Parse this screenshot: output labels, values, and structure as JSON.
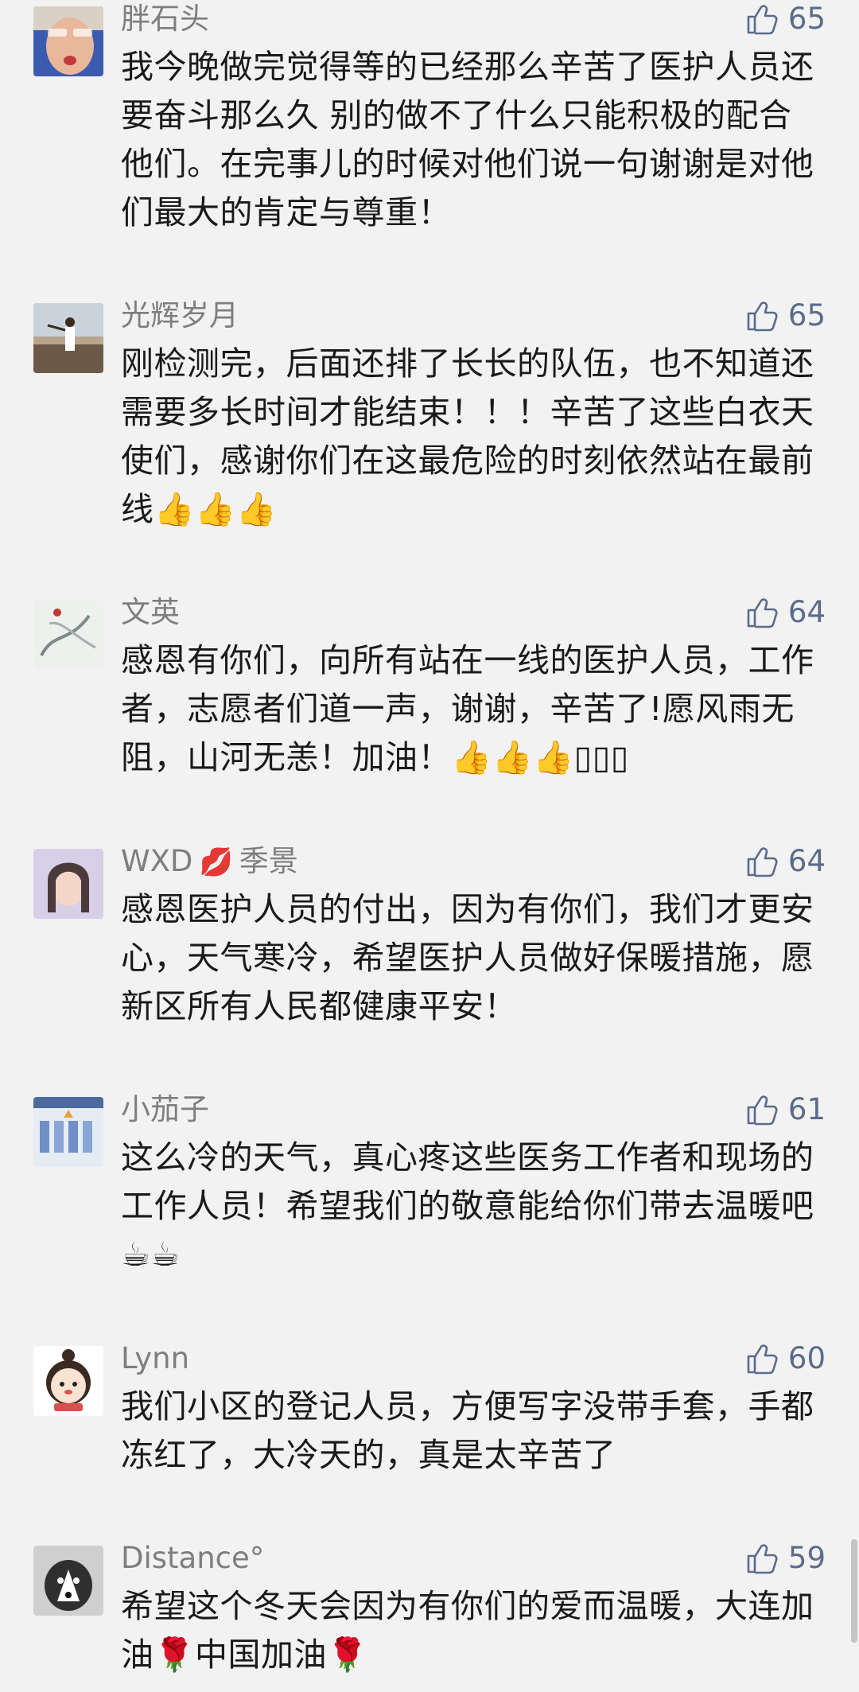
{
  "comments": [
    {
      "name": "胖石头",
      "likes": "65",
      "text": "我今晚做完觉得等的已经那么辛苦了医护人员还要奋斗那么久 别的做不了什么只能积极的配合他们。在完事儿的时候对他们说一句谢谢是对他们最大的肯定与尊重！"
    },
    {
      "name": "光辉岁月",
      "likes": "65",
      "text": "刚检测完，后面还排了长长的队伍，也不知道还需要多长时间才能结束！！！辛苦了这些白衣天使们，感谢你们在这最危险的时刻依然站在最前线👍👍👍"
    },
    {
      "name": "文英",
      "likes": "64",
      "text": "感恩有你们，向所有站在一线的医护人员，工作者，志愿者们道一声，谢谢，辛苦了!愿风雨无阻，山河无恙！加油！👍👍👍▯▯▯"
    },
    {
      "name": "WXD",
      "name_emoji": "💋",
      "name_suffix": "季景",
      "likes": "64",
      "text": "感恩医护人员的付出，因为有你们，我们才更安心，天气寒冷，希望医护人员做好保暖措施，愿新区所有人民都健康平安！"
    },
    {
      "name": "小茄子",
      "likes": "61",
      "text": "这么冷的天气，真心疼这些医务工作者和现场的工作人员！希望我们的敬意能给你们带去温暖吧☕☕"
    },
    {
      "name": "Lynn",
      "likes": "60",
      "text": "我们小区的登记人员，方便写字没带手套，手都冻红了，大冷天的，真是太辛苦了"
    },
    {
      "name": "Distance°",
      "likes": "59",
      "text": "希望这个冬天会因为有你们的爱而温暖，大连加油🌹中国加油🌹"
    }
  ]
}
